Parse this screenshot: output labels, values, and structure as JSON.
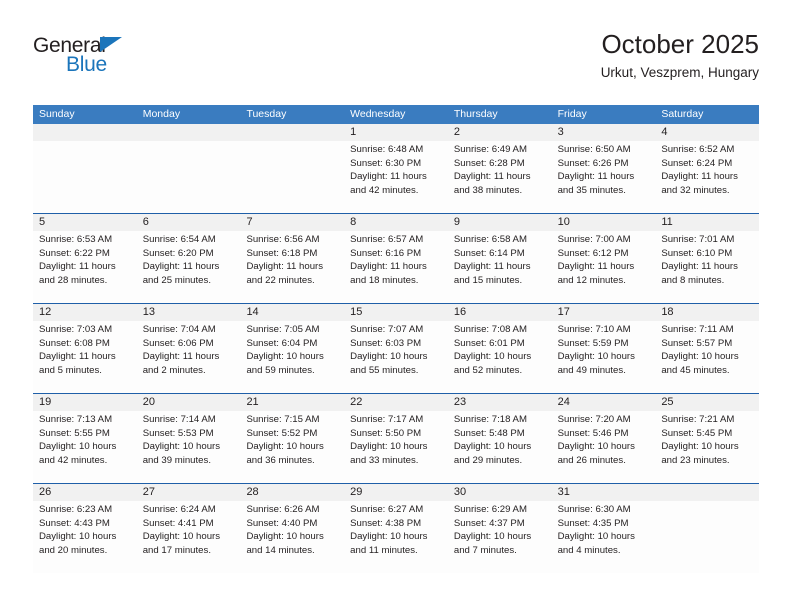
{
  "brand": {
    "name_primary": "General",
    "name_secondary": "Blue",
    "accent_color": "#1b75bb"
  },
  "header": {
    "title": "October 2025",
    "subtitle": "Urkut, Veszprem, Hungary"
  },
  "calendar": {
    "header_bg_color": "#3a7cc0",
    "row_divider_color": "#1f5fa8",
    "daynum_bg_color": "#f1f1f1",
    "weekdays": [
      "Sunday",
      "Monday",
      "Tuesday",
      "Wednesday",
      "Thursday",
      "Friday",
      "Saturday"
    ],
    "weeks": [
      [
        {
          "day": "",
          "lines": []
        },
        {
          "day": "",
          "lines": []
        },
        {
          "day": "",
          "lines": []
        },
        {
          "day": "1",
          "lines": [
            "Sunrise: 6:48 AM",
            "Sunset: 6:30 PM",
            "Daylight: 11 hours",
            "and 42 minutes."
          ]
        },
        {
          "day": "2",
          "lines": [
            "Sunrise: 6:49 AM",
            "Sunset: 6:28 PM",
            "Daylight: 11 hours",
            "and 38 minutes."
          ]
        },
        {
          "day": "3",
          "lines": [
            "Sunrise: 6:50 AM",
            "Sunset: 6:26 PM",
            "Daylight: 11 hours",
            "and 35 minutes."
          ]
        },
        {
          "day": "4",
          "lines": [
            "Sunrise: 6:52 AM",
            "Sunset: 6:24 PM",
            "Daylight: 11 hours",
            "and 32 minutes."
          ]
        }
      ],
      [
        {
          "day": "5",
          "lines": [
            "Sunrise: 6:53 AM",
            "Sunset: 6:22 PM",
            "Daylight: 11 hours",
            "and 28 minutes."
          ]
        },
        {
          "day": "6",
          "lines": [
            "Sunrise: 6:54 AM",
            "Sunset: 6:20 PM",
            "Daylight: 11 hours",
            "and 25 minutes."
          ]
        },
        {
          "day": "7",
          "lines": [
            "Sunrise: 6:56 AM",
            "Sunset: 6:18 PM",
            "Daylight: 11 hours",
            "and 22 minutes."
          ]
        },
        {
          "day": "8",
          "lines": [
            "Sunrise: 6:57 AM",
            "Sunset: 6:16 PM",
            "Daylight: 11 hours",
            "and 18 minutes."
          ]
        },
        {
          "day": "9",
          "lines": [
            "Sunrise: 6:58 AM",
            "Sunset: 6:14 PM",
            "Daylight: 11 hours",
            "and 15 minutes."
          ]
        },
        {
          "day": "10",
          "lines": [
            "Sunrise: 7:00 AM",
            "Sunset: 6:12 PM",
            "Daylight: 11 hours",
            "and 12 minutes."
          ]
        },
        {
          "day": "11",
          "lines": [
            "Sunrise: 7:01 AM",
            "Sunset: 6:10 PM",
            "Daylight: 11 hours",
            "and 8 minutes."
          ]
        }
      ],
      [
        {
          "day": "12",
          "lines": [
            "Sunrise: 7:03 AM",
            "Sunset: 6:08 PM",
            "Daylight: 11 hours",
            "and 5 minutes."
          ]
        },
        {
          "day": "13",
          "lines": [
            "Sunrise: 7:04 AM",
            "Sunset: 6:06 PM",
            "Daylight: 11 hours",
            "and 2 minutes."
          ]
        },
        {
          "day": "14",
          "lines": [
            "Sunrise: 7:05 AM",
            "Sunset: 6:04 PM",
            "Daylight: 10 hours",
            "and 59 minutes."
          ]
        },
        {
          "day": "15",
          "lines": [
            "Sunrise: 7:07 AM",
            "Sunset: 6:03 PM",
            "Daylight: 10 hours",
            "and 55 minutes."
          ]
        },
        {
          "day": "16",
          "lines": [
            "Sunrise: 7:08 AM",
            "Sunset: 6:01 PM",
            "Daylight: 10 hours",
            "and 52 minutes."
          ]
        },
        {
          "day": "17",
          "lines": [
            "Sunrise: 7:10 AM",
            "Sunset: 5:59 PM",
            "Daylight: 10 hours",
            "and 49 minutes."
          ]
        },
        {
          "day": "18",
          "lines": [
            "Sunrise: 7:11 AM",
            "Sunset: 5:57 PM",
            "Daylight: 10 hours",
            "and 45 minutes."
          ]
        }
      ],
      [
        {
          "day": "19",
          "lines": [
            "Sunrise: 7:13 AM",
            "Sunset: 5:55 PM",
            "Daylight: 10 hours",
            "and 42 minutes."
          ]
        },
        {
          "day": "20",
          "lines": [
            "Sunrise: 7:14 AM",
            "Sunset: 5:53 PM",
            "Daylight: 10 hours",
            "and 39 minutes."
          ]
        },
        {
          "day": "21",
          "lines": [
            "Sunrise: 7:15 AM",
            "Sunset: 5:52 PM",
            "Daylight: 10 hours",
            "and 36 minutes."
          ]
        },
        {
          "day": "22",
          "lines": [
            "Sunrise: 7:17 AM",
            "Sunset: 5:50 PM",
            "Daylight: 10 hours",
            "and 33 minutes."
          ]
        },
        {
          "day": "23",
          "lines": [
            "Sunrise: 7:18 AM",
            "Sunset: 5:48 PM",
            "Daylight: 10 hours",
            "and 29 minutes."
          ]
        },
        {
          "day": "24",
          "lines": [
            "Sunrise: 7:20 AM",
            "Sunset: 5:46 PM",
            "Daylight: 10 hours",
            "and 26 minutes."
          ]
        },
        {
          "day": "25",
          "lines": [
            "Sunrise: 7:21 AM",
            "Sunset: 5:45 PM",
            "Daylight: 10 hours",
            "and 23 minutes."
          ]
        }
      ],
      [
        {
          "day": "26",
          "lines": [
            "Sunrise: 6:23 AM",
            "Sunset: 4:43 PM",
            "Daylight: 10 hours",
            "and 20 minutes."
          ]
        },
        {
          "day": "27",
          "lines": [
            "Sunrise: 6:24 AM",
            "Sunset: 4:41 PM",
            "Daylight: 10 hours",
            "and 17 minutes."
          ]
        },
        {
          "day": "28",
          "lines": [
            "Sunrise: 6:26 AM",
            "Sunset: 4:40 PM",
            "Daylight: 10 hours",
            "and 14 minutes."
          ]
        },
        {
          "day": "29",
          "lines": [
            "Sunrise: 6:27 AM",
            "Sunset: 4:38 PM",
            "Daylight: 10 hours",
            "and 11 minutes."
          ]
        },
        {
          "day": "30",
          "lines": [
            "Sunrise: 6:29 AM",
            "Sunset: 4:37 PM",
            "Daylight: 10 hours",
            "and 7 minutes."
          ]
        },
        {
          "day": "31",
          "lines": [
            "Sunrise: 6:30 AM",
            "Sunset: 4:35 PM",
            "Daylight: 10 hours",
            "and 4 minutes."
          ]
        },
        {
          "day": "",
          "lines": []
        }
      ]
    ]
  }
}
